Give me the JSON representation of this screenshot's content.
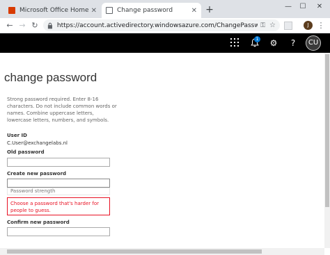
{
  "browser": {
    "tabs": [
      {
        "title": "Microsoft Office Home",
        "icon": "office-icon"
      },
      {
        "title": "Change password",
        "icon": "document-icon",
        "active": true
      }
    ],
    "url": "https://account.activedirectory.windowsazure.com/ChangePassword.aspx",
    "profile_initial": "J"
  },
  "header": {
    "notification_count": "1",
    "user_initials": "CU"
  },
  "page": {
    "title": "change password",
    "help_text": "Strong password required. Enter 8-16 characters. Do not include common words or names. Combine uppercase letters, lowercase letters, numbers, and symbols.",
    "user_id_label": "User ID",
    "user_id_value": "C.User@exchangelabs.nl",
    "old_password_label": "Old password",
    "new_password_label": "Create new password",
    "strength_text": "Password strength",
    "error_text": "Choose a password that's harder for people to guess.",
    "confirm_label": "Confirm new password"
  },
  "colors": {
    "appbar": "#000000",
    "error": "#e81123",
    "accent": "#0078d4"
  }
}
